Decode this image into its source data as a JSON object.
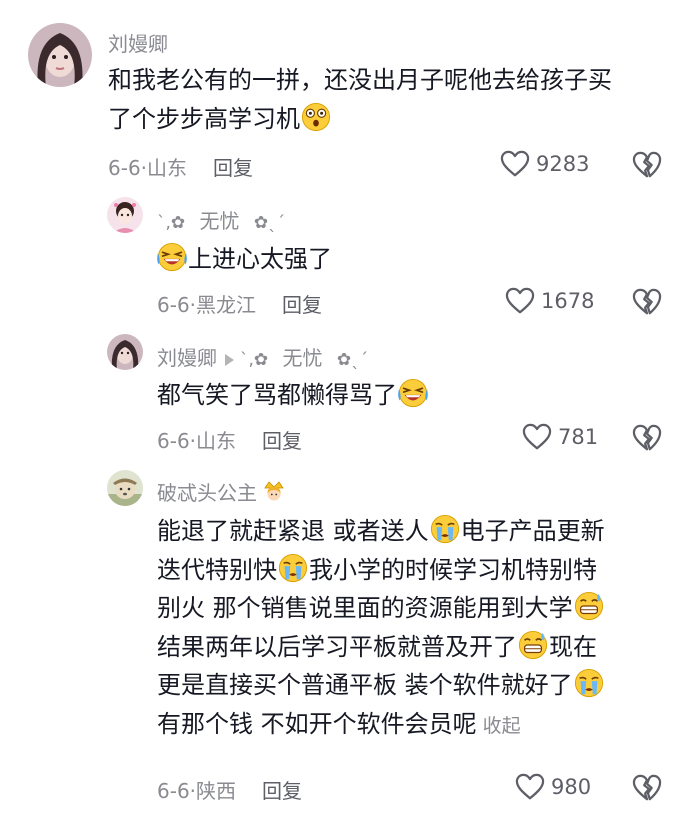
{
  "comments": [
    {
      "author": "刘嫚卿",
      "lines": [
        "和我老公有的一拼，还没出月子呢他去给孩子买",
        "了个步步高学习机"
      ],
      "date": "6-6",
      "location": "山东",
      "reply_label": "回复",
      "likes": "9283"
    },
    {
      "author": "无忧",
      "author_deco_left": "`,✿",
      "author_deco_right": "✿ˎˊ",
      "lines": [
        "上进心太强了"
      ],
      "date": "6-6",
      "location": "黑龙江",
      "reply_label": "回复",
      "likes": "1678"
    },
    {
      "author": "刘嫚卿",
      "reply_to": "无忧",
      "reply_to_deco_left": "`,✿",
      "reply_to_deco_right": "✿ˎˊ",
      "lines": [
        "都气笑了骂都懒得骂了"
      ],
      "date": "6-6",
      "location": "山东",
      "reply_label": "回复",
      "likes": "781"
    },
    {
      "author": "破忒头公主",
      "lines": [
        "能退了就赶紧退 或者送人",
        "电子产品更新",
        "迭代特别快",
        "我小学的时候学习机特别特",
        "别火 那个销售说里面的资源能用到大学",
        "结果两年以后学习平板就普及开了",
        "现在",
        "更是直接买个普通平板 装个软件就好了",
        "有那个钱 不如开个软件会员呢"
      ],
      "collapse_label": "收起",
      "date": "6-6",
      "location": "陕西",
      "reply_label": "回复",
      "likes": "980"
    }
  ],
  "icons": {
    "like": "heart-outline-icon",
    "dislike": "broken-heart-icon",
    "emoji_shocked": "shocked-face-emoji",
    "emoji_laugh_cry": "laugh-crying-emoji",
    "emoji_crying": "crying-face-emoji",
    "emoji_grin_sweat": "grin-sweat-emoji",
    "crown": "princess-crown-icon"
  },
  "colors": {
    "text": "#161823",
    "secondary": "#8a8b91",
    "action": "#5d5e66"
  }
}
